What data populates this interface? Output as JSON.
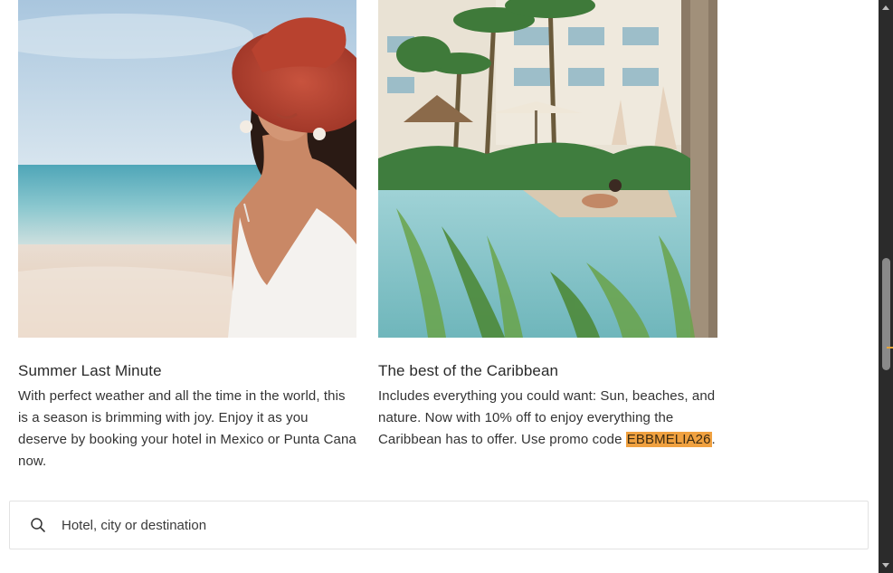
{
  "cards": [
    {
      "title": "Summer Last Minute",
      "description": "With perfect weather and all the time in the world, this is a season is brimming with joy. Enjoy it as you deserve by booking your hotel in Mexico or Punta Cana now."
    },
    {
      "title": "The best of the Caribbean",
      "description_before": "Includes everything you could want: Sun, beaches, and nature. Now with 10% off to enjoy everything the Caribbean has to offer. Use promo code ",
      "promo_code": "EBBMELIA26",
      "description_after": "."
    }
  ],
  "search": {
    "placeholder": "Hotel, city or destination",
    "icon": "search-icon"
  },
  "colors": {
    "promo_highlight": "#f0a140",
    "scrollbar_track": "#2b2b2b",
    "scrollbar_thumb": "#8a8a8a"
  }
}
